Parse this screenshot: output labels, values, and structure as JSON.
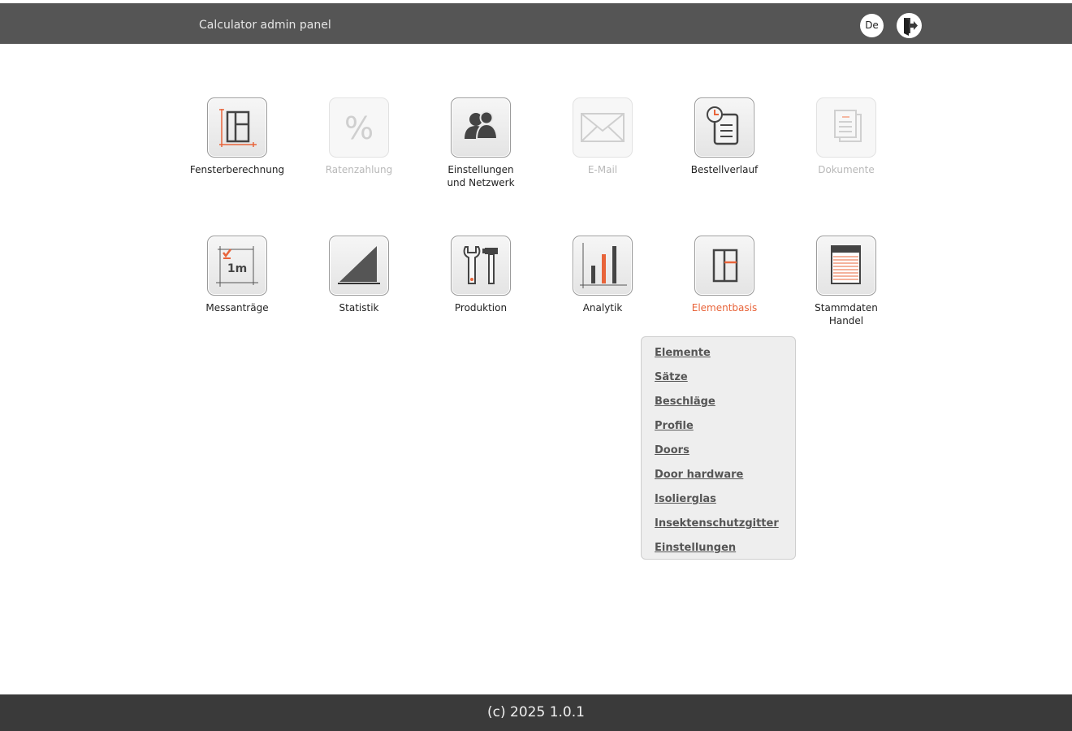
{
  "header": {
    "title": "Calculator admin panel",
    "language": "De",
    "logout_icon": "logout-door-icon"
  },
  "tiles_row1": [
    {
      "label": "Fensterberechnung",
      "icon": "window-calculation-icon",
      "enabled": true
    },
    {
      "label": "Ratenzahlung",
      "icon": "percent-icon",
      "enabled": false
    },
    {
      "label": "Einstellungen\nund Netzwerk",
      "icon": "users-network-icon",
      "enabled": true
    },
    {
      "label": "E-Mail",
      "icon": "envelope-icon",
      "enabled": false
    },
    {
      "label": "Bestellverlauf",
      "icon": "order-history-icon",
      "enabled": true
    },
    {
      "label": "Dokumente",
      "icon": "documents-icon",
      "enabled": false
    }
  ],
  "tiles_row2": [
    {
      "label": "Messanträge",
      "icon": "measurement-icon",
      "enabled": true
    },
    {
      "label": "Statistik",
      "icon": "statistics-triangle-icon",
      "enabled": true
    },
    {
      "label": "Produktion",
      "icon": "tools-icon",
      "enabled": true
    },
    {
      "label": "Analytik",
      "icon": "bar-chart-icon",
      "enabled": true
    },
    {
      "label": "Elementbasis",
      "icon": "element-base-icon",
      "enabled": true,
      "active": true
    },
    {
      "label": "Stammdaten\nHandel",
      "icon": "master-data-icon",
      "enabled": true
    }
  ],
  "dropdown": {
    "items": [
      "Elemente",
      "Sätze",
      "Beschläge",
      "Profile",
      "Doors",
      "Door hardware",
      "Isolierglas",
      "Insektenschutzgitter",
      "Einstellungen"
    ]
  },
  "footer": {
    "text": "(c) 2025 1.0.1"
  },
  "colors": {
    "header_bg": "#555555",
    "footer_bg": "#3a3a3a",
    "accent": "#e8643a",
    "dropdown_bg": "#eeeeee"
  }
}
